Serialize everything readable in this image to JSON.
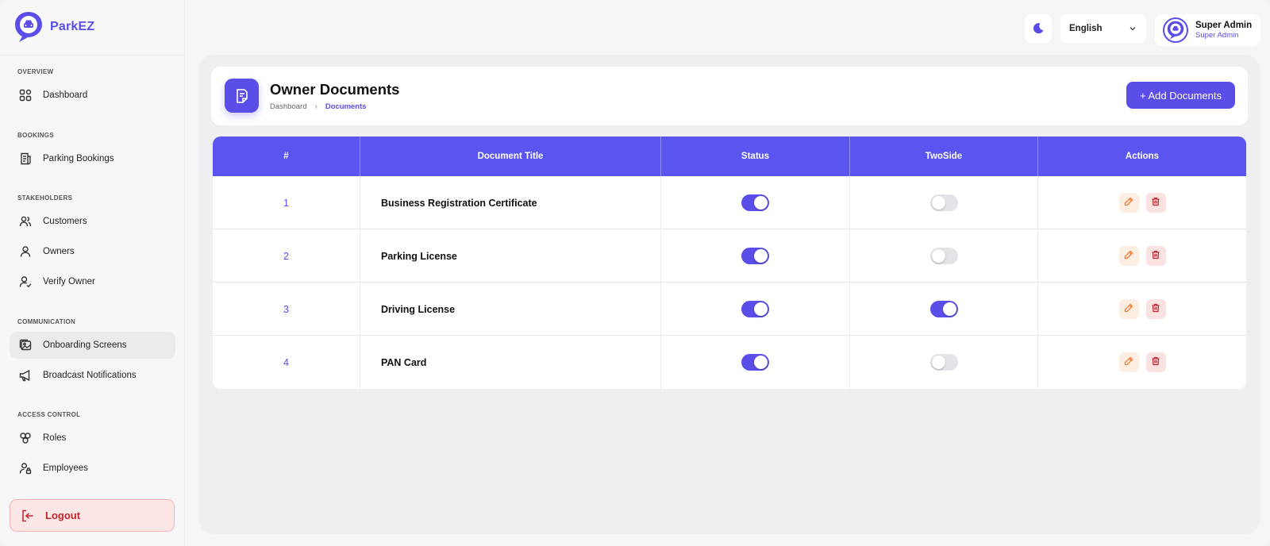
{
  "brand": {
    "name": "ParkEZ"
  },
  "sidebar": {
    "sections": [
      {
        "label": "OVERVIEW"
      },
      {
        "label": "BOOKINGS"
      },
      {
        "label": "STAKEHOLDERS"
      },
      {
        "label": "COMMUNICATION"
      },
      {
        "label": "ACCESS CONTROL"
      }
    ],
    "items": [
      {
        "label": "Dashboard",
        "icon": "grid-icon"
      },
      {
        "label": "Parking Bookings",
        "icon": "receipt-icon"
      },
      {
        "label": "Customers",
        "icon": "users-icon"
      },
      {
        "label": "Owners",
        "icon": "user-icon"
      },
      {
        "label": "Verify Owner",
        "icon": "user-check-icon"
      },
      {
        "label": "Onboarding Screens",
        "icon": "image-icon",
        "active": true
      },
      {
        "label": "Broadcast Notifications",
        "icon": "megaphone-icon"
      },
      {
        "label": "Roles",
        "icon": "roles-icon"
      },
      {
        "label": "Employees",
        "icon": "user-lock-icon"
      }
    ],
    "logout_label": "Logout"
  },
  "topbar": {
    "language": "English",
    "user": {
      "name": "Super Admin",
      "role": "Super Admin"
    }
  },
  "page": {
    "title": "Owner Documents",
    "breadcrumb": [
      "Dashboard",
      "Documents"
    ],
    "add_button": "+ Add Documents"
  },
  "table": {
    "headers": [
      "#",
      "Document Title",
      "Status",
      "TwoSide",
      "Actions"
    ],
    "rows": [
      {
        "num": "1",
        "title": "Business Registration Certificate",
        "status": true,
        "two_side": false
      },
      {
        "num": "2",
        "title": "Parking License",
        "status": true,
        "two_side": false
      },
      {
        "num": "3",
        "title": "Driving License",
        "status": true,
        "two_side": true
      },
      {
        "num": "4",
        "title": "PAN Card",
        "status": true,
        "two_side": false
      }
    ]
  },
  "colors": {
    "accent": "#5b4ee8",
    "danger": "#c0262e",
    "edit": "#f07a2a"
  }
}
